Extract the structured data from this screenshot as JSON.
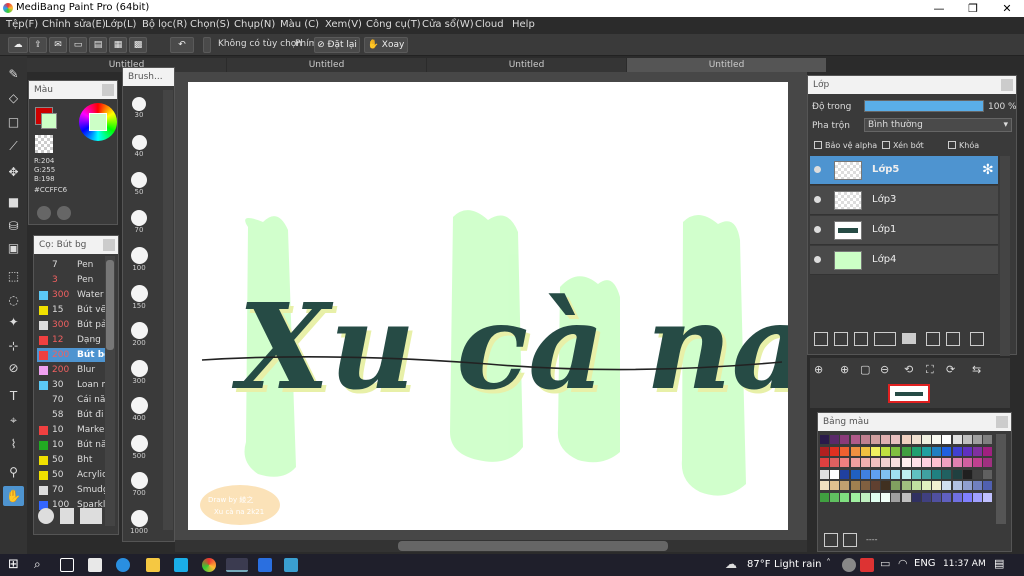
{
  "window": {
    "title": "MediBang Paint Pro (64bit)",
    "minimize": "—",
    "maximize": "❐",
    "close": "✕"
  },
  "menu": [
    "Tệp(F)",
    "Chỉnh sửa(E)",
    "Lớp(L)",
    "Bộ lọc(R)",
    "Chọn(S)",
    "Chụp(N)",
    "Màu (C)",
    "Xem(V)",
    "Công cụ(T)",
    "Cửa sổ(W)",
    "Cloud",
    "Help"
  ],
  "toolbar": {
    "snap_label": "Không có tùy chọn",
    "key_label": "Phím",
    "reset_label": "Đặt lại",
    "rotate_label": "Xoay"
  },
  "tabs": [
    "Untitled",
    "Untitled",
    "Untitled",
    "Untitled"
  ],
  "color_panel": {
    "title": "Màu",
    "r": "R:204",
    "g": "G:255",
    "b": "B:198",
    "hex": "#CCFFC6"
  },
  "brush_panel": {
    "title": "Brush...",
    "sizes": [
      "30",
      "40",
      "50",
      "70",
      "100",
      "150",
      "200",
      "300",
      "400",
      "500",
      "700",
      "1000"
    ]
  },
  "brush_list": {
    "title": "Cọ: Bút bg",
    "items": [
      {
        "size": "7",
        "name": "Pen",
        "color": "#3a3a3a",
        "size_color": "#ddd"
      },
      {
        "size": "3",
        "name": "Pen",
        "color": "#3a3a3a",
        "size_color": "#f06060"
      },
      {
        "size": "300",
        "name": "Water",
        "color": "#5bc8f5",
        "size_color": "#f06060"
      },
      {
        "size": "15",
        "name": "Bút vẽ",
        "color": "#f0e000",
        "size_color": "#ddd"
      },
      {
        "size": "300",
        "name": "Bút pả",
        "color": "#dddddd",
        "size_color": "#f06060"
      },
      {
        "size": "12",
        "name": "Dạng",
        "color": "#f04040",
        "size_color": "#f06060"
      },
      {
        "size": "200",
        "name": "Bút bg",
        "color": "#f04040",
        "size_color": "#f06060"
      },
      {
        "size": "200",
        "name": "Blur",
        "color": "#f0a0f0",
        "size_color": "#f06060"
      },
      {
        "size": "30",
        "name": "Loan m",
        "color": "#5bc8f5",
        "size_color": "#ddd"
      },
      {
        "size": "70",
        "name": "Cái nă",
        "color": "#3a3a3a",
        "size_color": "#ddd"
      },
      {
        "size": "58",
        "name": "Bút đi",
        "color": "#3a3a3a",
        "size_color": "#ddd"
      },
      {
        "size": "10",
        "name": "Marke",
        "color": "#f04040",
        "size_color": "#ddd"
      },
      {
        "size": "10",
        "name": "Bút nă",
        "color": "#22aa22",
        "size_color": "#ddd"
      },
      {
        "size": "50",
        "name": "Bht",
        "color": "#f0e000",
        "size_color": "#ddd"
      },
      {
        "size": "50",
        "name": "Acrylic",
        "color": "#f0e000",
        "size_color": "#ddd"
      },
      {
        "size": "70",
        "name": "Smudg",
        "color": "#dddddd",
        "size_color": "#ddd"
      },
      {
        "size": "100",
        "name": "Sparkl",
        "color": "#3366ff",
        "size_color": "#ddd"
      }
    ]
  },
  "canvas": {
    "text": "Xu cà na",
    "watermark_line1": "Draw by 綾之",
    "watermark_line2": "Xu cà na 2k21"
  },
  "layer_panel": {
    "title": "Lớp",
    "opacity_label": "Độ trong",
    "opacity_value": "100 %",
    "opacity": 1.0,
    "blend_label": "Pha trộn",
    "blend_value": "Bình thường",
    "protect_alpha": "Bảo vệ alpha",
    "clipping": "Xén bớt",
    "lock": "Khóa",
    "layers": [
      "Lớp5",
      "Lớp3",
      "Lớp1",
      "Lớp4"
    ]
  },
  "swatch_panel": {
    "title": "Bảng màu",
    "footer": "----"
  },
  "taskbar": {
    "weather_temp": "87°F",
    "weather_text": "Light rain",
    "lang": "ENG",
    "time": "11:37 AM"
  },
  "colors": {
    "accent": "#4e94d0",
    "fg": "#cc0000",
    "canvas_text": "#264b45",
    "highlight": "#ccffc6"
  }
}
